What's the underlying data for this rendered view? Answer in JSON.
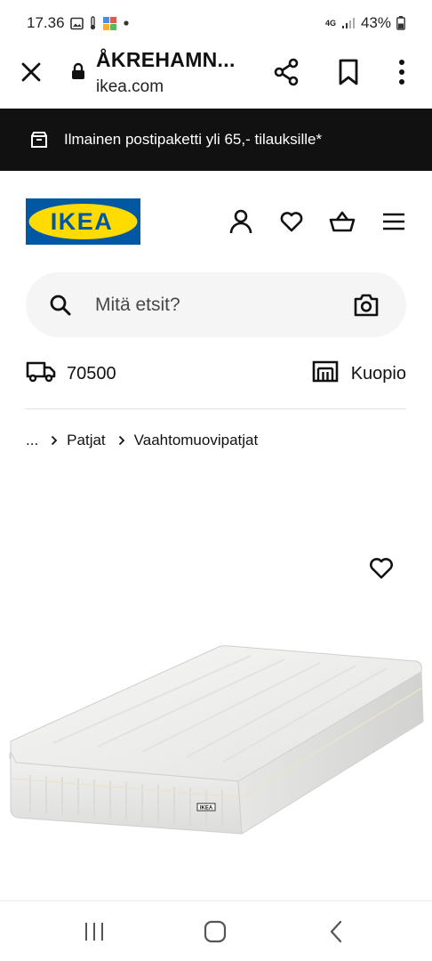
{
  "status_bar": {
    "time": "17.36",
    "network": "4G",
    "battery": "43%"
  },
  "browser": {
    "page_title": "ÅKREHAMN...",
    "url": "ikea.com",
    "icons": [
      "close-icon",
      "lock-icon",
      "share-icon",
      "bookmark-icon",
      "more-vertical-icon"
    ]
  },
  "promo": {
    "text": "Ilmainen postipaketti yli 65,- tilauksille*",
    "icon": "parcel-icon"
  },
  "header": {
    "logo_text": "IKEA",
    "brand_colors": {
      "blue": "#0058a3",
      "yellow": "#ffdb00"
    },
    "icons": [
      "user-icon",
      "heart-icon",
      "basket-icon",
      "menu-icon"
    ]
  },
  "search": {
    "placeholder": "Mitä etsit?",
    "icons": [
      "search-icon",
      "camera-icon"
    ]
  },
  "location": {
    "postcode": "70500",
    "store": "Kuopio",
    "icons": [
      "delivery-truck-icon",
      "store-icon"
    ]
  },
  "breadcrumb": {
    "ellipsis": "...",
    "items": [
      "Patjat",
      "Vaahtomuovipatjat"
    ]
  },
  "product": {
    "image": "white foam mattress",
    "badge": "IKEA",
    "favourite_icon": "heart-icon"
  },
  "nav_bar": {
    "icons": [
      "recent-apps-icon",
      "home-icon",
      "back-icon"
    ]
  }
}
